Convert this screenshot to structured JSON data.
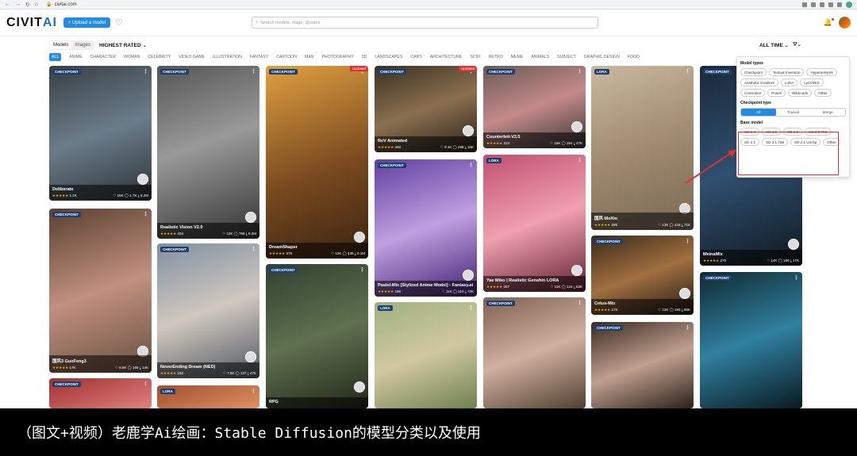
{
  "browser": {
    "url": "civitai.com"
  },
  "header": {
    "logo_a": "CIVIT",
    "logo_b": "AI",
    "upload_label": "+ Upload a model",
    "search_placeholder": "Search models, #tags, @users"
  },
  "toolbar": {
    "tabs": [
      "Models",
      "Images"
    ],
    "sort": "HIGHEST RATED",
    "time": "ALL TIME"
  },
  "categories": [
    "ALL",
    "ANIME",
    "CHARACTER",
    "WOMAN",
    "CELEBRITY",
    "VIDEO GAME",
    "ILLUSTRATION",
    "FANTASY",
    "CARTOON",
    "MAN",
    "PHOTOGRAPHY",
    "3D",
    "LANDSCAPES",
    "CARS",
    "ARCHITECTURE",
    "SCIFI",
    "RETRO",
    "MEME",
    "ANIMALS",
    "SUBJECT",
    "GRAPHIC DESIGN",
    "FOOD"
  ],
  "cards": [
    {
      "type": "CHECKPOINT",
      "name": "Deliberate",
      "stars": "★★★★★",
      "rating": "1.1K",
      "likes": "15K",
      "comments": "1.7K",
      "downloads": "8.2M"
    },
    {
      "type": "CHECKPOINT",
      "name": "Realistic Vision V2.0",
      "stars": "★★★★★",
      "rating": "434",
      "likes": "12K",
      "comments": "768",
      "downloads": "8.2M"
    },
    {
      "type": "CHECKPOINT",
      "name": "DreamShaper",
      "stars": "★★★★★",
      "rating": "379",
      "likes": "12K",
      "comments": "535",
      "downloads": "0.1M",
      "badge": "Updated"
    },
    {
      "type": "CHECKPOINT",
      "name": "ReV Animated",
      "stars": "★★★★★",
      "rating": "348",
      "likes": "9.1K",
      "comments": "298",
      "downloads": "16K",
      "badge": "Updated"
    },
    {
      "type": "CHECKPOINT",
      "name": "Counterfeit-V2.5",
      "stars": "★★★★★",
      "rating": "313",
      "likes": "16K",
      "comments": "264",
      "downloads": "47K"
    },
    {
      "type": "LORA",
      "name": "国风 MoXin",
      "stars": "★★★★★",
      "rating": "295",
      "likes": "13K",
      "comments": "418",
      "downloads": "71K"
    },
    {
      "type": "CHECKPOINT",
      "name": "MeinaMix",
      "stars": "★★★★★",
      "rating": "270",
      "likes": "14K",
      "comments": "199",
      "downloads": "17K"
    },
    {
      "type": "CHECKPOINT",
      "name": "国风3 GuoFeng3",
      "stars": "★★★★★",
      "rating": "17K",
      "likes": "9.6K",
      "comments": "165",
      "downloads": "14K"
    },
    {
      "type": "CHECKPOINT",
      "name": "NeverEnding Dream (NED)",
      "stars": "★★★★★",
      "rating": "152",
      "likes": "7.5K",
      "comments": "137",
      "downloads": "47K"
    },
    {
      "type": "CHECKPOINT",
      "name": "RPG",
      "stars": "",
      "rating": "",
      "likes": "",
      "comments": "",
      "downloads": ""
    },
    {
      "type": "CHECKPOINT",
      "name": "Pastel-Mix [Stylized Anime Model] - Fantasy.ai",
      "stars": "★★★★★",
      "rating": "198",
      "likes": "11K",
      "comments": "110",
      "downloads": "72K"
    },
    {
      "type": "LORA",
      "name": "Yae Miko | Realistic Genshin LORA",
      "stars": "★★★★★",
      "rating": "207",
      "likes": "11K",
      "comments": "124",
      "downloads": "83K"
    },
    {
      "type": "CHECKPOINT",
      "name": "Cetus-Mix",
      "stars": "★★★★★",
      "rating": "176",
      "likes": "12K",
      "comments": "193",
      "downloads": "80K"
    },
    {
      "type": "LORA",
      "name": "",
      "stars": "",
      "rating": "",
      "likes": "",
      "comments": "",
      "downloads": ""
    },
    {
      "type": "CHECKPOINT",
      "name": "",
      "stars": "",
      "rating": "",
      "likes": "",
      "comments": "",
      "downloads": ""
    },
    {
      "type": "CHECKPOINT",
      "name": "",
      "stars": "",
      "rating": "",
      "likes": "",
      "comments": "",
      "downloads": ""
    },
    {
      "type": "CHECKPOINT",
      "name": "",
      "stars": "",
      "rating": "",
      "likes": "",
      "comments": "",
      "downloads": ""
    },
    {
      "type": "CHECKPOINT",
      "name": "",
      "stars": "",
      "rating": "",
      "likes": "",
      "comments": "",
      "downloads": ""
    },
    {
      "type": "LORA",
      "name": "",
      "stars": "",
      "rating": "",
      "likes": "",
      "comments": "",
      "downloads": ""
    }
  ],
  "filter_panel": {
    "model_types_title": "Model types",
    "model_types": [
      "Checkpoint",
      "Textual Inversion",
      "Hypernetwork",
      "Aesthetic Gradient",
      "LoRA",
      "LyCORIS",
      "Controlnet",
      "Poses",
      "Wildcards",
      "Other"
    ],
    "checkpoint_type_title": "Checkpoint type",
    "checkpoint_types": [
      "All",
      "Trained",
      "Merge"
    ],
    "base_model_title": "Base model",
    "base_models": [
      "SD 1.4",
      "SD 1.5",
      "SD 2.0",
      "SD 2.0 768",
      "SD 2.1",
      "SD 2.1 768",
      "SD 2.1 Unclip",
      "Other"
    ]
  },
  "subtitle": "（图文+视频）老鹿学Ai绘画：Stable Diffusion的模型分类以及使用"
}
